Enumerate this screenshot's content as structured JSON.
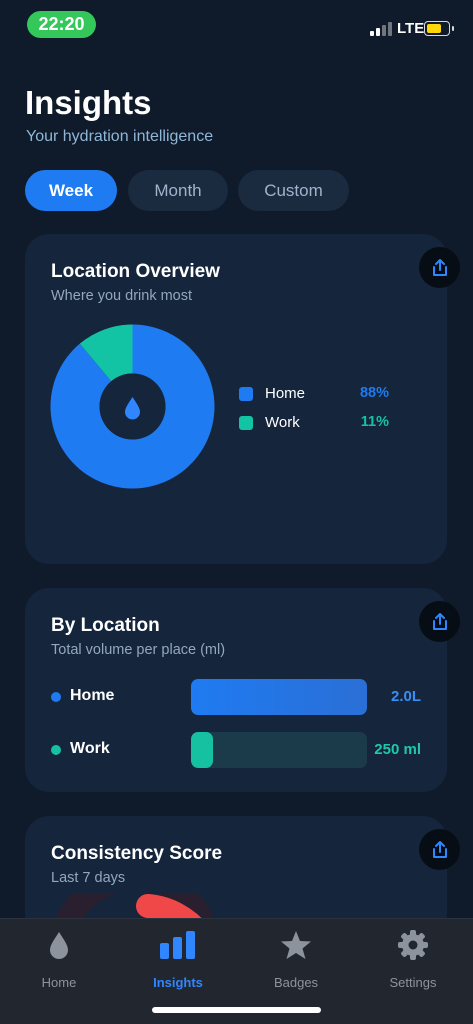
{
  "status_bar": {
    "time": "22:20",
    "network": "LTE",
    "battery_level": 0.7,
    "battery_color": "#ffd60a"
  },
  "header": {
    "title": "Insights",
    "subtitle": "Your hydration intelligence"
  },
  "period_tabs": [
    {
      "label": "Week",
      "active": true
    },
    {
      "label": "Month",
      "active": false
    },
    {
      "label": "Custom",
      "active": false
    }
  ],
  "location_overview": {
    "title": "Location Overview",
    "subtitle": "Where you drink most",
    "center_icon": "water-drop-icon",
    "share_icon": "share-icon",
    "legend": [
      {
        "label": "Home",
        "value": "88%",
        "color": "#1f7bf2"
      },
      {
        "label": "Work",
        "value": "11%",
        "color": "#12c3a4"
      }
    ]
  },
  "by_location": {
    "title": "By Location",
    "subtitle": "Total volume per place (ml)",
    "share_icon": "share-icon",
    "rows": [
      {
        "label": "Home",
        "value": "2.0L",
        "fraction": 1.0,
        "color": "#1f7bf2",
        "value_color": "#3a8df5"
      },
      {
        "label": "Work",
        "value": "250 ml",
        "fraction": 0.125,
        "color": "#16c1a1",
        "value_color": "#1fc9a8"
      }
    ]
  },
  "consistency": {
    "title": "Consistency Score",
    "subtitle": "Last 7 days",
    "share_icon": "share-icon",
    "gauge_color": "#f04848"
  },
  "chart_data": {
    "type": "pie",
    "categories": [
      "Home",
      "Work"
    ],
    "values": [
      88,
      11
    ],
    "colors": [
      "#1f7bf2",
      "#12c3a4"
    ]
  },
  "tab_bar": {
    "items": [
      {
        "label": "Home",
        "icon": "water-drop-icon",
        "active": false
      },
      {
        "label": "Insights",
        "icon": "bar-chart-icon",
        "active": true
      },
      {
        "label": "Badges",
        "icon": "star-icon",
        "active": false
      },
      {
        "label": "Settings",
        "icon": "gear-icon",
        "active": false
      }
    ]
  }
}
